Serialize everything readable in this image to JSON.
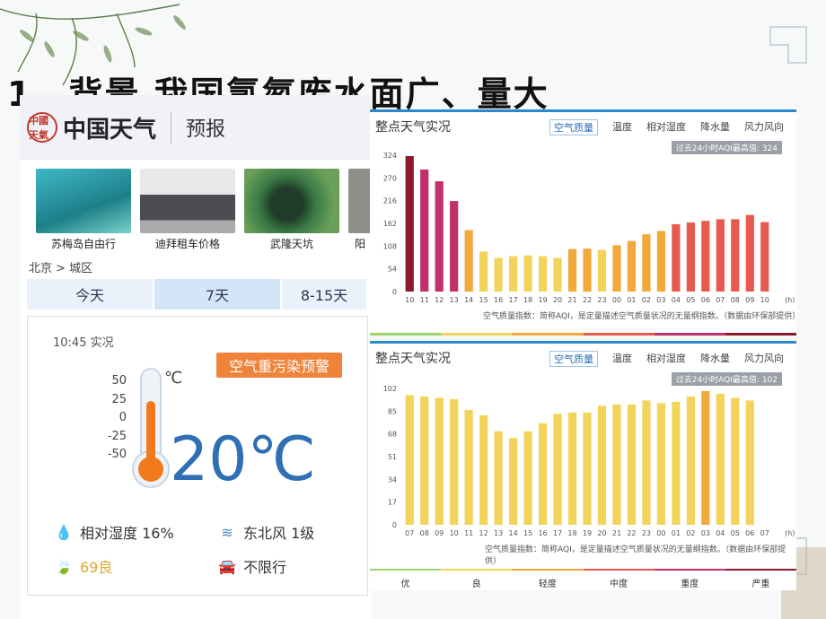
{
  "slide": {
    "title": "1、背景 我国氯氮废水面广、量大"
  },
  "left": {
    "brand": "中国天气",
    "logo": "中國天氣",
    "forecast_label": "预报",
    "thumbs": [
      {
        "caption": "苏梅岛自由行"
      },
      {
        "caption": "迪拜租车价格"
      },
      {
        "caption": "武隆天坑"
      },
      {
        "caption": "阳"
      }
    ],
    "breadcrumb": "北京 > 城区",
    "tabs": [
      "今天",
      "7天",
      "8-15天"
    ],
    "now": {
      "time": "10:45 实况",
      "alert": "空气重污染预警",
      "scale": [
        "50",
        "25",
        "0",
        "-25",
        "-50"
      ],
      "unit": "℃",
      "temp": "20℃",
      "humidity": "相对湿度 16%",
      "wind": "东北风 1级",
      "aqi": "69良",
      "traffic": "不限行"
    }
  },
  "chart_top": {
    "title": "整点天气实况",
    "tabs": [
      "空气质量",
      "温度",
      "相对湿度",
      "降水量",
      "风力风向"
    ],
    "badge": "过去24小时AQI最高值: 324",
    "note": "空气质量指数：简称AQI，是定量描述空气质量状况的无量纲指数。（数据由环保部提供）",
    "xunit": "(h)"
  },
  "chart_bot": {
    "title": "整点天气实况",
    "tabs": [
      "空气质量",
      "温度",
      "相对湿度",
      "降水量",
      "风力风向"
    ],
    "badge": "过去24小时AQI最高值: 102",
    "note": "空气质量指数：简称AQI，是定量描述空气质量状况的无量纲指数。（数据由环保部提供）",
    "xunit": "(h)"
  },
  "legend": [
    "优",
    "良",
    "轻度",
    "中度",
    "重度",
    "严重"
  ],
  "colors": {
    "accent": "#2b89c9",
    "temp": "#2f6fb3",
    "alert": "#f0833a",
    "good": "#f2d45c",
    "light": "#f0a93a",
    "moderate": "#e65a4f",
    "heavy": "#c0306a",
    "severe": "#8a1a2c"
  },
  "chart_data": [
    {
      "type": "bar",
      "categories": [
        "10",
        "11",
        "12",
        "13",
        "14",
        "15",
        "16",
        "17",
        "18",
        "19",
        "20",
        "21",
        "22",
        "23",
        "00",
        "01",
        "02",
        "03",
        "04",
        "05",
        "06",
        "07",
        "08",
        "09",
        "10"
      ],
      "values": [
        322,
        290,
        262,
        215,
        146,
        95,
        80,
        84,
        86,
        84,
        80,
        101,
        102,
        99,
        110,
        120,
        136,
        144,
        160,
        164,
        168,
        172,
        172,
        182,
        165
      ],
      "ylim": [
        0,
        324
      ],
      "yticks": [
        0,
        54,
        108,
        162,
        216,
        270,
        324
      ]
    },
    {
      "type": "bar",
      "categories": [
        "07",
        "08",
        "09",
        "10",
        "11",
        "12",
        "13",
        "14",
        "15",
        "16",
        "17",
        "18",
        "19",
        "20",
        "21",
        "22",
        "23",
        "00",
        "01",
        "02",
        "03",
        "04",
        "05",
        "06",
        "07"
      ],
      "values": [
        97,
        96,
        95,
        94,
        86,
        82,
        70,
        65,
        70,
        76,
        83,
        84,
        84,
        89,
        90,
        90,
        93,
        91,
        92,
        96,
        100,
        98,
        95,
        93,
        0
      ],
      "ylim": [
        0,
        102
      ],
      "yticks": [
        0,
        17,
        34,
        51,
        68,
        85,
        102
      ]
    }
  ]
}
